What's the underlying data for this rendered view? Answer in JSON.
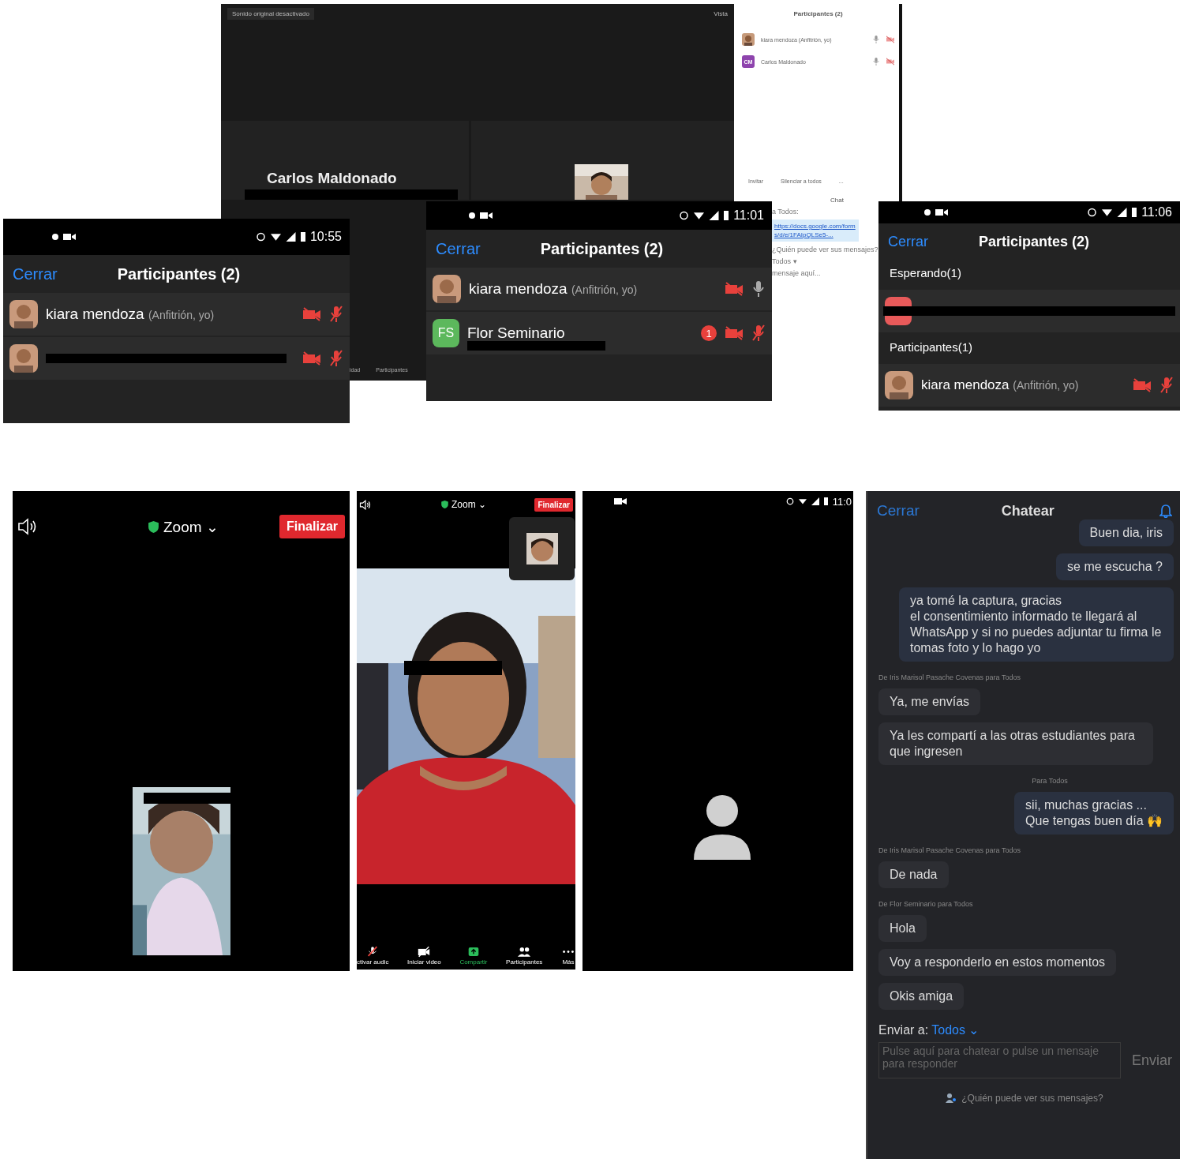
{
  "desktop_meeting": {
    "audio_button": "Sonido original desactivado",
    "view_button": "Vista",
    "tiles": [
      {
        "kind": "name",
        "name": "Carlos Maldonado",
        "redacted": true
      },
      {
        "kind": "picture"
      }
    ],
    "toolbar": [
      {
        "label": "idad"
      },
      {
        "label": "Participantes"
      }
    ]
  },
  "desktop_participants": {
    "title": "Participantes (2)",
    "rows": [
      {
        "name": "kiara mendoza (Anfitrión, yo)",
        "kind": "picture"
      },
      {
        "name": "Carlos Maldonado",
        "kind": "initials",
        "initials": "CM",
        "color": "#8e44ad"
      }
    ],
    "buttons": [
      "Invitar",
      "Silenciar a todos",
      "..."
    ],
    "chat": {
      "title": "Chat",
      "recipient": "a Todos:",
      "link": "https://docs.google.com/forms/d/e/1FAIpQLSe5-...",
      "privacy": "¿Quién puede ver sus mensajes?",
      "send_to": "Todos ▾",
      "placeholder": "mensaje aquí..."
    }
  },
  "phone_lists": [
    {
      "time": "10:55",
      "close": "Cerrar",
      "title": "Participantes (2)",
      "sections": [
        {
          "rows": [
            {
              "name": "kiara mendoza",
              "role": "(Anfitrión, yo)",
              "kind": "picture",
              "video_on": false,
              "mic_on": false
            },
            {
              "name": "",
              "redacted": true,
              "kind": "picture",
              "video_on": false,
              "mic_on": false
            }
          ]
        }
      ]
    },
    {
      "time": "11:01",
      "close": "Cerrar",
      "title": "Participantes (2)",
      "sections": [
        {
          "rows": [
            {
              "name": "kiara mendoza",
              "role": "(Anfitrión, yo)",
              "kind": "picture",
              "video_on": false,
              "mic_on": true
            },
            {
              "name": "Flor Seminario",
              "redacted": true,
              "kind": "initials",
              "initials": "FS",
              "color": "#5cb85c",
              "badge": "1",
              "video_on": false,
              "mic_on": false
            }
          ]
        }
      ]
    },
    {
      "time": "11:06",
      "close": "Cerrar",
      "title": "Participantes (2)",
      "sections": [
        {
          "heading": "Esperando(1)",
          "rows": [
            {
              "name": "",
              "redacted": true,
              "kind": "initials",
              "color": "#e85a5a"
            }
          ]
        },
        {
          "heading": "Participantes(1)",
          "rows": [
            {
              "name": "kiara mendoza",
              "role": "(Anfitrión, yo)",
              "kind": "picture",
              "video_on": false,
              "mic_on": false
            }
          ]
        }
      ]
    }
  ],
  "call_a": {
    "app": "Zoom ⌄",
    "end": "Finalizar"
  },
  "call_b": {
    "app": "Zoom ⌄",
    "end": "Finalizar",
    "toolbar": [
      {
        "kind": "mic",
        "label": "ctivar audic",
        "highlighted": false
      },
      {
        "kind": "video",
        "label": "Iniciar video",
        "highlighted": false
      },
      {
        "kind": "share",
        "label": "Compartir",
        "highlighted": true
      },
      {
        "kind": "people",
        "label": "Participantes",
        "highlighted": false
      },
      {
        "kind": "more",
        "label": "Más",
        "highlighted": false
      }
    ]
  },
  "call_c": {
    "time": "11:0"
  },
  "chat": {
    "close": "Cerrar",
    "title": "Chatear",
    "items": [
      {
        "kind": "message",
        "mine": true,
        "text": "Buen dia, iris"
      },
      {
        "kind": "message",
        "mine": true,
        "text": "se me escucha ?"
      },
      {
        "kind": "message",
        "mine": true,
        "text": "ya tomé la captura, gracias\nel consentimiento informado te llegará al WhatsApp y si no puedes adjuntar tu firma le tomas foto y lo hago yo"
      },
      {
        "kind": "label",
        "mine": false,
        "text": "De Iris Marisol Pasache Covenas para Todos"
      },
      {
        "kind": "message",
        "mine": false,
        "text": "Ya, me envías"
      },
      {
        "kind": "message",
        "mine": false,
        "text": "Ya les compartí a las otras estudiantes para que ingresen"
      },
      {
        "kind": "label",
        "mine": true,
        "text": "Para Todos"
      },
      {
        "kind": "message",
        "mine": true,
        "text": "sii, muchas gracias ...\nQue tengas buen día 🙌"
      },
      {
        "kind": "label",
        "mine": false,
        "text": "De Iris Marisol Pasache Covenas para Todos"
      },
      {
        "kind": "message",
        "mine": false,
        "text": "De nada"
      },
      {
        "kind": "label",
        "mine": false,
        "text": "De Flor Seminario para Todos"
      },
      {
        "kind": "message",
        "mine": false,
        "text": "Hola"
      },
      {
        "kind": "message",
        "mine": false,
        "text": "Voy a responderlo en estos momentos"
      },
      {
        "kind": "message",
        "mine": false,
        "text": "Okis amiga"
      }
    ],
    "send_to_label": "Enviar a:",
    "send_to": "Todos ⌄",
    "placeholder": "Pulse aquí para chatear o pulse un mensaje para responder",
    "send": "Enviar",
    "privacy": "¿Quién puede ver sus mensajes?"
  }
}
